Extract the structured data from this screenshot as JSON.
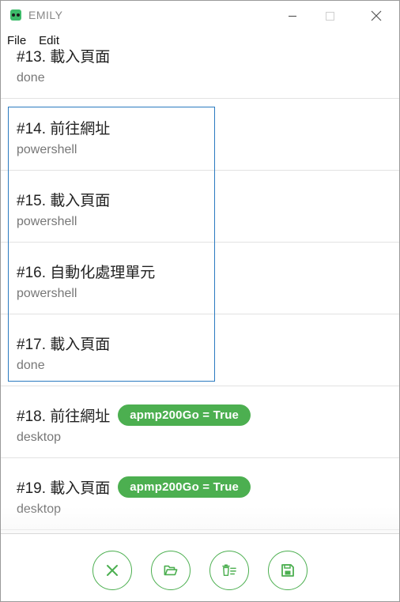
{
  "window": {
    "title": "EMILY"
  },
  "menu": {
    "file": "File",
    "edit": "Edit"
  },
  "rows": [
    {
      "title": "#13. 載入頁面",
      "sub": "done"
    },
    {
      "title": "#14. 前往網址",
      "sub": "powershell"
    },
    {
      "title": "#15. 載入頁面",
      "sub": "powershell"
    },
    {
      "title": "#16. 自動化處理單元",
      "sub": "powershell"
    },
    {
      "title": "#17. 載入頁面",
      "sub": "done"
    },
    {
      "title": "#18. 前往網址",
      "sub": "desktop",
      "badge": "apmp200Go = True"
    },
    {
      "title": "#19. 載入頁面",
      "sub": "desktop",
      "badge": "apmp200Go = True"
    }
  ],
  "footer": {
    "buttons": [
      "close-icon",
      "folder-open-icon",
      "delete-list-icon",
      "save-icon"
    ]
  },
  "colors": {
    "accent": "#4caf50",
    "selection": "#2a7ac0"
  }
}
